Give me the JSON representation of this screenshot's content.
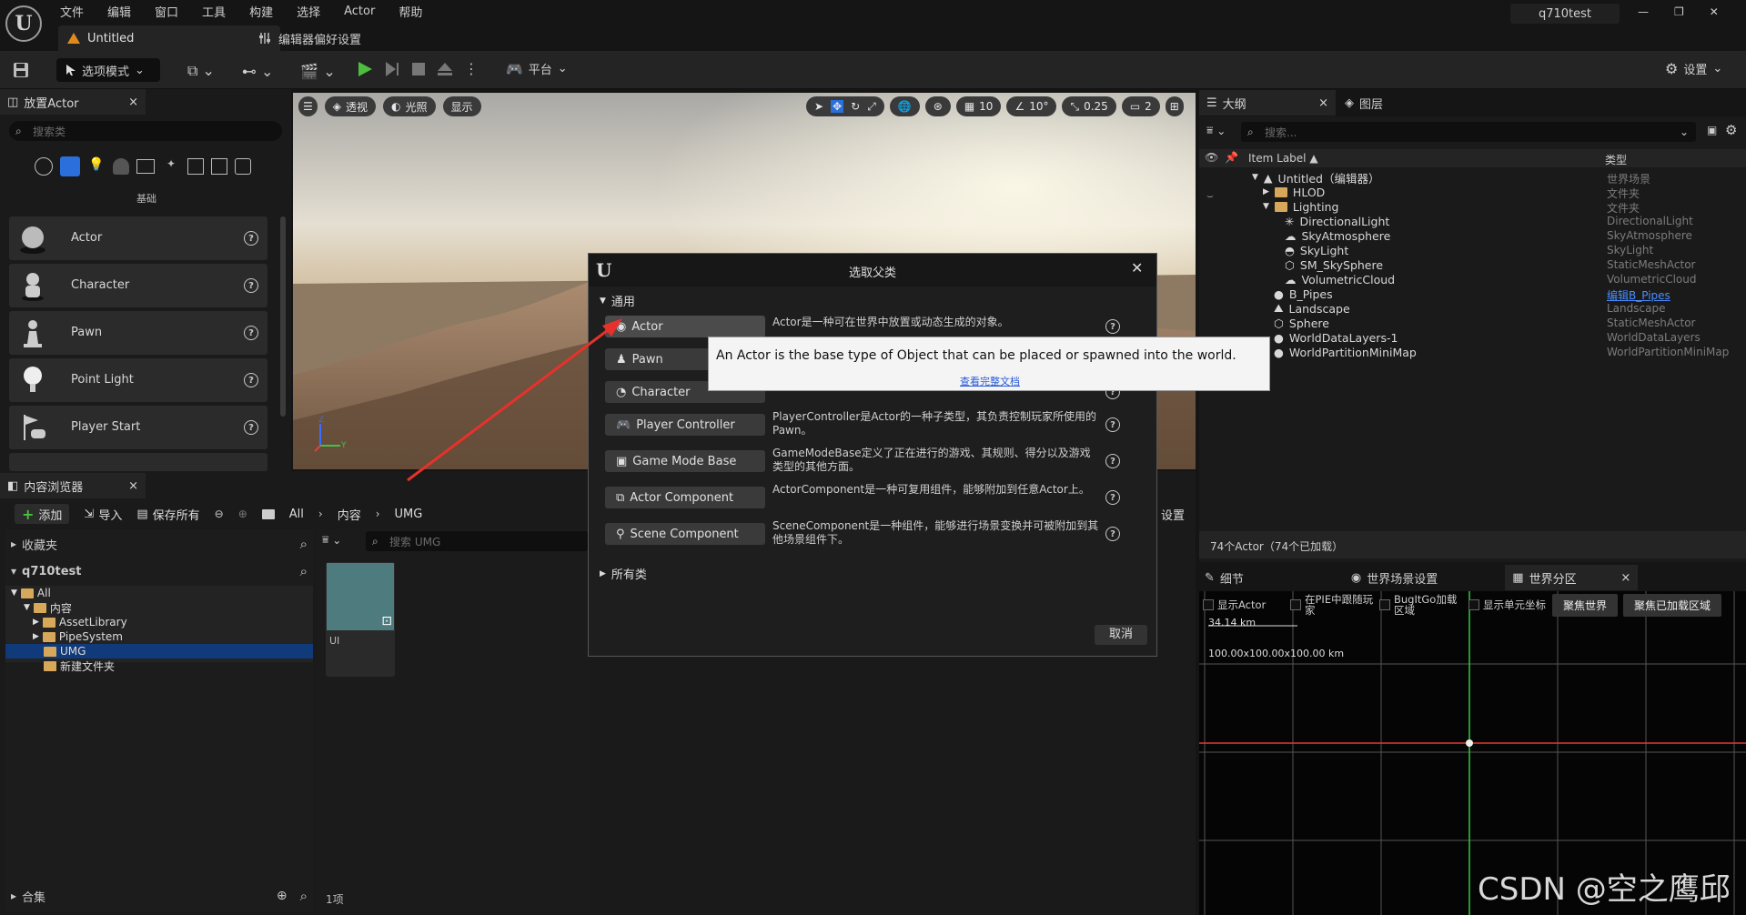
{
  "menu": [
    "文件",
    "编辑",
    "窗口",
    "工具",
    "构建",
    "选择",
    "Actor",
    "帮助"
  ],
  "tabs": {
    "level": "Untitled",
    "prefs": "编辑器偏好设置"
  },
  "window": {
    "title": "q710test"
  },
  "toolbar": {
    "mode": "选项模式",
    "platform": "平台",
    "settings": "设置"
  },
  "place_actors": {
    "tab": "放置Actor",
    "search_placeholder": "搜索类",
    "category": "基础",
    "items": [
      "Actor",
      "Character",
      "Pawn",
      "Point Light",
      "Player Start"
    ]
  },
  "viewport": {
    "perspective": "透视",
    "lit": "光照",
    "show": "显示",
    "grid": "10",
    "angle": "10°",
    "scale": "0.25",
    "camera": "2"
  },
  "content_browser": {
    "tab": "内容浏览器",
    "add": "添加",
    "import": "导入",
    "save_all": "保存所有",
    "path": [
      "All",
      "内容",
      "UMG"
    ],
    "settings": "设置",
    "favorites": "收藏夹",
    "project": "q710test",
    "tree": [
      "All",
      "内容",
      "AssetLibrary",
      "PipeSystem",
      "UMG",
      "新建文件夹"
    ],
    "search_placeholder": "搜索 UMG",
    "asset_label": "UI",
    "count": "1项",
    "collections": "合集"
  },
  "dialog": {
    "title": "选取父类",
    "section_common": "通用",
    "section_all": "所有类",
    "cancel": "取消",
    "classes": [
      {
        "name": "Actor",
        "desc": "Actor是一种可在世界中放置或动态生成的对象。"
      },
      {
        "name": "Pawn",
        "desc": ""
      },
      {
        "name": "Character",
        "desc": ""
      },
      {
        "name": "Player Controller",
        "desc": "PlayerController是Actor的一种子类型，其负责控制玩家所使用的Pawn。"
      },
      {
        "name": "Game Mode Base",
        "desc": "GameModeBase定义了正在进行的游戏、其规则、得分以及游戏类型的其他方面。"
      },
      {
        "name": "Actor Component",
        "desc": "ActorComponent是一种可复用组件，能够附加到任意Actor上。"
      },
      {
        "name": "Scene Component",
        "desc": "SceneComponent是一种组件，能够进行场景变换并可被附加到其他场景组件下。"
      }
    ],
    "tooltip": "An Actor is the base type of Object that can be placed or spawned into the world.",
    "tooltip_link": "查看完整文档"
  },
  "outliner": {
    "tab": "大纲",
    "tab_layers": "图层",
    "search_placeholder": "搜索...",
    "col_label": "Item Label ▲",
    "col_type": "类型",
    "rows": [
      {
        "label": "Untitled（编辑器）",
        "type": "世界场景"
      },
      {
        "label": "HLOD",
        "type": "文件夹"
      },
      {
        "label": "Lighting",
        "type": "文件夹"
      },
      {
        "label": "DirectionalLight",
        "type": "DirectionalLight"
      },
      {
        "label": "SkyAtmosphere",
        "type": "SkyAtmosphere"
      },
      {
        "label": "SkyLight",
        "type": "SkyLight"
      },
      {
        "label": "SM_SkySphere",
        "type": "StaticMeshActor"
      },
      {
        "label": "VolumetricCloud",
        "type": "VolumetricCloud"
      },
      {
        "label": "B_Pipes",
        "type": "编辑B_Pipes"
      },
      {
        "label": "Landscape",
        "type": "Landscape"
      },
      {
        "label": "Sphere",
        "type": "StaticMeshActor"
      },
      {
        "label": "WorldDataLayers-1",
        "type": "WorldDataLayers"
      },
      {
        "label": "WorldPartitionMiniMap",
        "type": "WorldPartitionMiniMap"
      }
    ],
    "footer": "74个Actor（74个已加载）"
  },
  "details": {
    "tab_details": "细节",
    "tab_world_settings": "世界场景设置",
    "tab_world_partition": "世界分区",
    "opt_show_actor": "显示Actor",
    "opt_follow_player": "在PIE中跟随玩家",
    "opt_bugitgo": "BugItGo加载区域",
    "opt_cell_coords": "显示单元坐标",
    "focus_world": "聚焦世界",
    "focus_loaded": "聚焦已加载区域",
    "scale_label": "34.14 km",
    "size_label": "100.00x100.00x100.00 km"
  },
  "watermark": "CSDN @空之鹰邱"
}
